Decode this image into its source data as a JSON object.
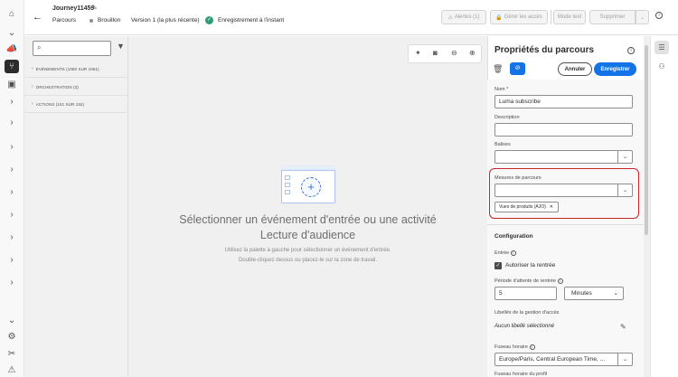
{
  "header": {
    "journey_name": "Journey11459",
    "back_icon": "arrow-left-icon",
    "parcours_label": "Parcours",
    "status": "Brouillon",
    "version": "Version 1 (la plus récente)",
    "saved": "Enregistrement à l'instant",
    "alerts": "Alertes (1)",
    "manage_access": "Gérer les accès",
    "test_mode": "Mode test",
    "delete": "Supprimer"
  },
  "palette": {
    "search_placeholder": "",
    "items": [
      {
        "label": "ÉVÉNEMENTS (1060 SUR 1061)"
      },
      {
        "label": "ORCHESTRATION (3)"
      },
      {
        "label": "ACTIONS (151 SUR 152)"
      }
    ]
  },
  "canvas": {
    "headline_line1": "Sélectionner un événement d'entrée ou une activité",
    "headline_line2": "Lecture d'audience",
    "help_line1": "Utilisez la palette à gauche pour sélectionner un événement d'entrée.",
    "help_line2": "Double-cliquez dessus ou placez-le sur la zone de travail."
  },
  "properties": {
    "title": "Propriétés du parcours",
    "cancel": "Annuler",
    "save": "Enregistrer",
    "name_label": "Nom",
    "name_value": "Luma subscribe",
    "description_label": "Description",
    "description_value": "",
    "tags_label": "Balises",
    "metrics_label": "Mesures de parcours",
    "metrics_tag": "Vues de produits (AJO)",
    "config_title": "Configuration",
    "entry_label": "Entrée",
    "allow_reentry": "Autoriser la rentrée",
    "wait_label": "Période d'attente de rentrée",
    "wait_value": "5",
    "wait_unit": "Minutes",
    "access_label": "Libellés de la gestion d'accès",
    "access_value": "Aucun libellé sélectionné",
    "timezone_label": "Fuseau horaire",
    "timezone_value": "Europe/Paris, Central European Time, ...",
    "profile_tz_label": "Fuseau horaire du profil"
  }
}
